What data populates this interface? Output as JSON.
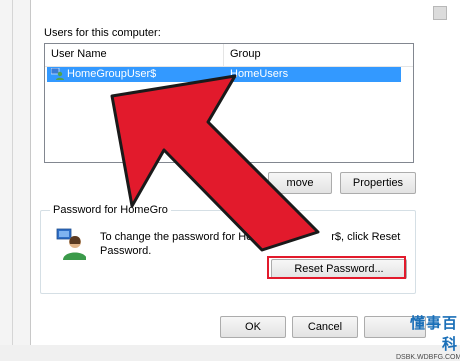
{
  "users_section": {
    "label": "Users for this computer:",
    "columns": [
      "User Name",
      "Group"
    ],
    "rows": [
      {
        "user_name": "HomeGroupUser$",
        "group": "HomeUsers",
        "selected": true,
        "icon": "user-group-icon"
      }
    ]
  },
  "buttons": {
    "remove": "move",
    "properties": "Properties",
    "reset_password": "Reset Password...",
    "ok": "OK",
    "cancel": "Cancel"
  },
  "password_section": {
    "legend": "Password for HomeGro",
    "line1": "To change the password for Ho",
    "line1_end": "r$, click Reset",
    "line2": "Password.",
    "icon": "user-password-icon"
  },
  "annotation": {
    "arrow_color": "#e21a2c",
    "highlight_color": "#e21a2c"
  },
  "watermark": {
    "main": "懂事百科",
    "sub": "DSBK.WDBFG.COM"
  },
  "colors": {
    "selection": "#3399ff",
    "accent": "#1a6fb8"
  }
}
